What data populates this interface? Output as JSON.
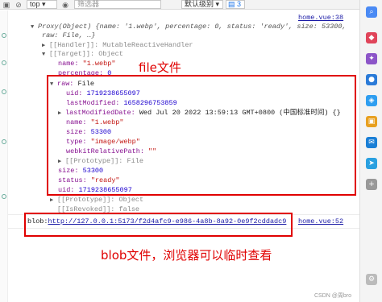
{
  "toolbar": {
    "context": "top",
    "filter_placeholder": "筛选器",
    "level": "默认级别",
    "issues_count": "3"
  },
  "console": {
    "source_top": "home.vue:38",
    "summary_line1": "Proxy(Object) {name: '1.webp', percentage: 0, status: 'ready', size: 53300,",
    "summary_line2": "raw: File, …}",
    "handler": "[[Handler]]: MutableReactiveHandler",
    "target": "[[Target]]: Object",
    "name_key": "name:",
    "name_val": "\"1.webp\"",
    "percentage_key": "percentage:",
    "percentage_val": "0",
    "raw_key": "raw:",
    "raw_val": "File",
    "uid_key": "uid:",
    "uid_val": "1719238655097",
    "lastModified_key": "lastModified:",
    "lastModified_val": "1658296753859",
    "lastModifiedDate_key": "lastModifiedDate:",
    "lastModifiedDate_val": "Wed Jul 20 2022 13:59:13 GMT+0800 (中国标准时间) {}",
    "inner_name_key": "name:",
    "inner_name_val": "\"1.webp\"",
    "size_key": "size:",
    "size_val": "53300",
    "type_key": "type:",
    "type_val": "\"image/webp\"",
    "webkit_key": "webkitRelativePath:",
    "webkit_val": "\"\"",
    "proto_file": "[[Prototype]]: File",
    "outer_size_key": "size:",
    "outer_size_val": "53300",
    "status_key": "status:",
    "status_val": "\"ready\"",
    "outer_uid_key": "uid:",
    "outer_uid_val": "1719238655097",
    "proto_object": "[[Prototype]]: Object",
    "isrevoked": "[[IsRevoked]]: false",
    "blob_prefix": "blob:",
    "blob_url": "http://127.0.0.1:5173/f2d4afc9-e986-4a8b-8a92-0e9f2cddadc9",
    "source_bottom": "home.vue:52"
  },
  "annotations": {
    "file_label": "file文件",
    "blob_label": "blob文件，浏览器可以临时查看"
  },
  "watermark": "CSDN @周bro",
  "colors": {
    "annotation": "#e00000",
    "key": "#881391",
    "string": "#c41a16",
    "number": "#1c00cf"
  }
}
